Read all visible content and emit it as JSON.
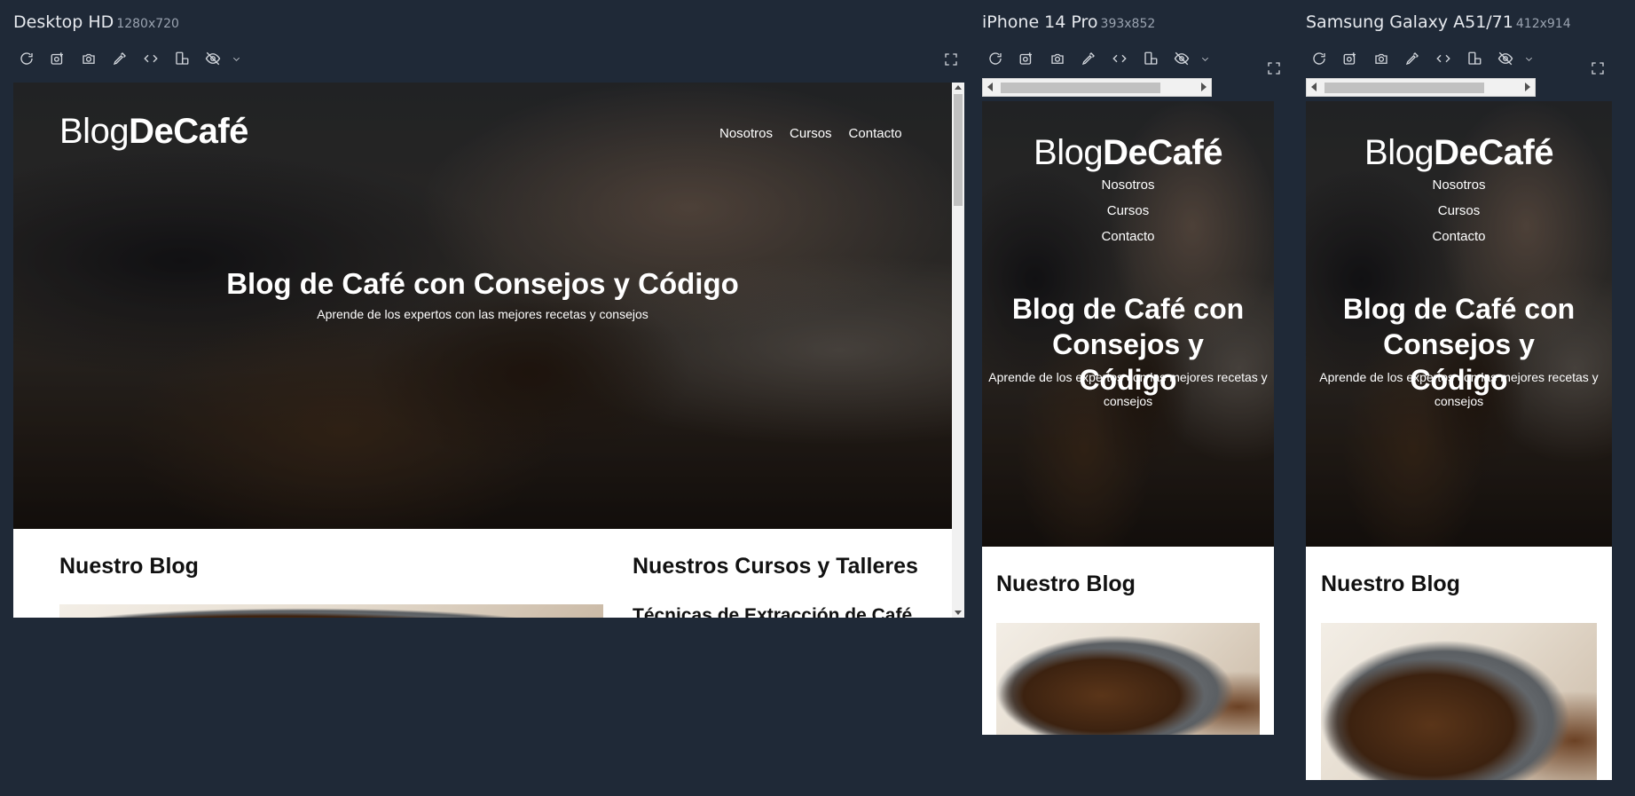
{
  "devices": [
    {
      "name": "Desktop HD",
      "dims": "1280x720",
      "site": {
        "logo_thin": "Blog",
        "logo_bold": "DeCafé",
        "nav": [
          "Nosotros",
          "Cursos",
          "Contacto"
        ],
        "hero_title": "Blog de Café con Consejos y Código",
        "hero_subtitle": "Aprende de los expertos con las mejores recetas y consejos",
        "blog_heading": "Nuestro Blog",
        "courses_heading": "Nuestros Cursos y Talleres",
        "course_1": "Técnicas de Extracción de Café"
      }
    },
    {
      "name": "iPhone 14 Pro",
      "dims": "393x852",
      "site": {
        "logo_thin": "Blog",
        "logo_bold": "DeCafé",
        "nav": [
          "Nosotros",
          "Cursos",
          "Contacto"
        ],
        "hero_title": "Blog de Café con Consejos y Código",
        "hero_subtitle": "Aprende de los expertos con las mejores recetas y consejos",
        "blog_heading": "Nuestro Blog"
      }
    },
    {
      "name": "Samsung Galaxy A51/71",
      "dims": "412x914",
      "site": {
        "logo_thin": "Blog",
        "logo_bold": "DeCafé",
        "nav": [
          "Nosotros",
          "Cursos",
          "Contacto"
        ],
        "hero_title": "Blog de Café con Consejos y Código",
        "hero_subtitle": "Aprende de los expertos con las mejores recetas y consejos",
        "blog_heading": "Nuestro Blog"
      }
    }
  ],
  "toolbar_icons": [
    "refresh-icon",
    "screenshot-icon",
    "camera-icon",
    "eyedropper-icon",
    "code-icon",
    "rotate-icon",
    "eye-off-icon",
    "chevron-down-icon"
  ],
  "colors": {
    "background": "#1f2937",
    "page": "#ffffff"
  }
}
